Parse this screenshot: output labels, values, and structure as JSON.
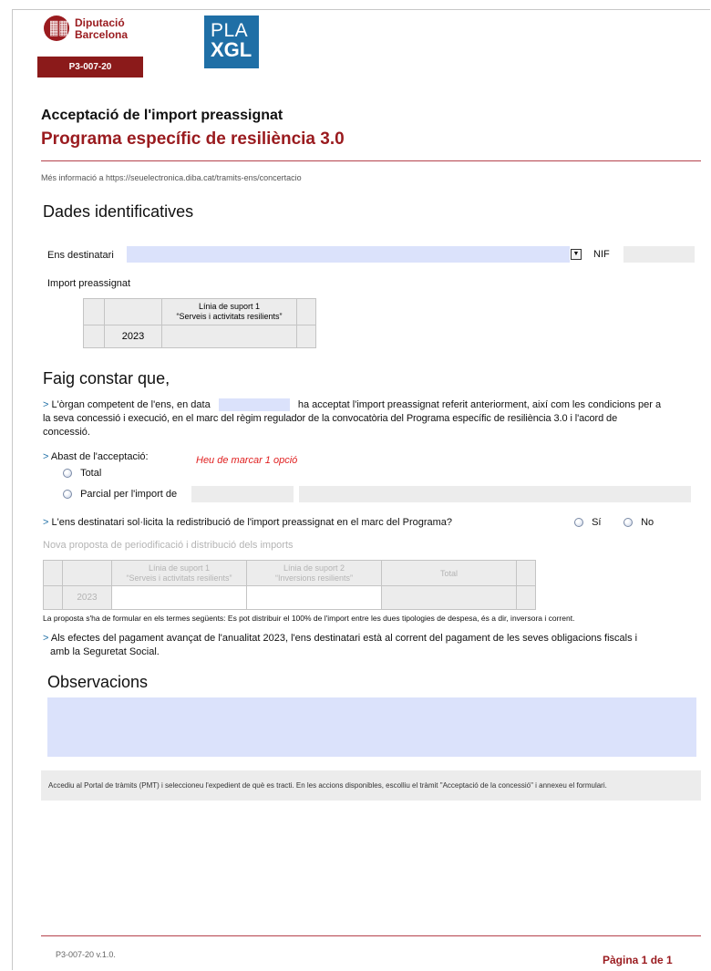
{
  "header": {
    "org_line1": "Diputació",
    "org_line2": "Barcelona",
    "form_code": "P3-007-20",
    "pla_line1": "PLA",
    "pla_line2": "XGL"
  },
  "title": {
    "line1": "Acceptació de l'import preassignat",
    "line2": "Programa específic de resiliència 3.0"
  },
  "info_text": "Més informació a https://seuelectronica.diba.cat/tramits-ens/concertacio",
  "dades": {
    "heading": "Dades identificatives",
    "ens_label": "Ens destinatari",
    "ens_value": "",
    "nif_label": "NIF",
    "nif_value": "",
    "import_label": "Import preassignat",
    "table": {
      "col_header_line1": "Línia de suport 1",
      "col_header_line2": "“Serveis i activitats resilients”",
      "row_year": "2023",
      "row_value": ""
    }
  },
  "faig": {
    "heading": "Faig constar que,",
    "para1_before": "L'òrgan competent de l'ens, en data",
    "para1_after_line": "ha acceptat l'import preassignat referit anteriorment, així com les condicions per a",
    "para1_line2": "la seva concessió i execució, en el marc del règim regulador de la convocatòria del Programa específic de resiliència 3.0 i l'acord de",
    "para1_line3": "concessió.",
    "abast_label": "Abast de l'acceptació:",
    "warning": "Heu de marcar 1 opció",
    "opt_total": "Total",
    "opt_parcial": "Parcial per l'import de",
    "redistrib_q": "L'ens destinatari sol·licita la redistribució de l'import preassignat en el marc del Programa?",
    "opt_si": "Sí",
    "opt_no": "No",
    "nova_proposta": "Nova proposta de periodificació i distribució dels imports",
    "table2": {
      "c1_line1": "Línia de suport 1",
      "c1_line2": "“Serveis i activitats resilients”",
      "c2_line1": "Línia de suport 2",
      "c2_line2": "“Inversions resilients”",
      "c3": "Total",
      "row_year": "2023"
    },
    "proposta_note": "La proposta s'ha de formular en els termes següents: Es pot distribuir el 100% de l'import entre les dues tipologies de despesa, és a dir, inversora i corrent.",
    "pagament_line1": "Als efectes del pagament avançat de l'anualitat 2023, l'ens destinatari està al corrent del pagament de les seves obligacions fiscals i",
    "pagament_line2": "amb la Seguretat Social."
  },
  "observacions": {
    "heading": "Observacions",
    "value": ""
  },
  "footer": {
    "note": "Accediu al Portal de tràmits (PMT) i seleccioneu l'expedient de què es tracti. En les accions disponibles, escolliu el tràmit \"Acceptació de la concessió\" i annexeu el formulari.",
    "code_version": "P3-007-20 v.1.0.",
    "page_label": "Pàgina 1 de 1"
  },
  "colors": {
    "brand_red": "#9a1b1f",
    "pla_blue": "#1f6fa6",
    "field_blue": "#dbe2fb",
    "field_gray": "#ececec"
  },
  "icons": [
    "diputacio-seal-icon",
    "dropdown-arrow-icon",
    "radio-icon"
  ]
}
